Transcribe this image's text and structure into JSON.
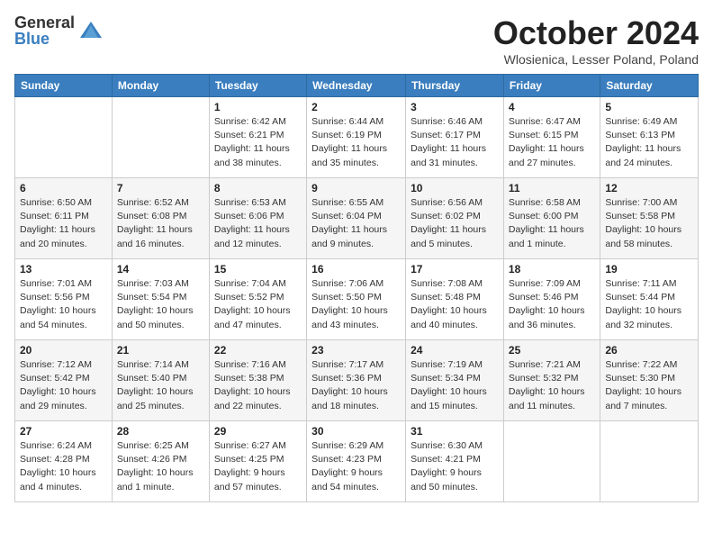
{
  "header": {
    "logo_general": "General",
    "logo_blue": "Blue",
    "month_title": "October 2024",
    "subtitle": "Wlosienica, Lesser Poland, Poland"
  },
  "calendar": {
    "days_of_week": [
      "Sunday",
      "Monday",
      "Tuesday",
      "Wednesday",
      "Thursday",
      "Friday",
      "Saturday"
    ],
    "weeks": [
      [
        {
          "day": "",
          "info": ""
        },
        {
          "day": "",
          "info": ""
        },
        {
          "day": "1",
          "info": "Sunrise: 6:42 AM\nSunset: 6:21 PM\nDaylight: 11 hours and 38 minutes."
        },
        {
          "day": "2",
          "info": "Sunrise: 6:44 AM\nSunset: 6:19 PM\nDaylight: 11 hours and 35 minutes."
        },
        {
          "day": "3",
          "info": "Sunrise: 6:46 AM\nSunset: 6:17 PM\nDaylight: 11 hours and 31 minutes."
        },
        {
          "day": "4",
          "info": "Sunrise: 6:47 AM\nSunset: 6:15 PM\nDaylight: 11 hours and 27 minutes."
        },
        {
          "day": "5",
          "info": "Sunrise: 6:49 AM\nSunset: 6:13 PM\nDaylight: 11 hours and 24 minutes."
        }
      ],
      [
        {
          "day": "6",
          "info": "Sunrise: 6:50 AM\nSunset: 6:11 PM\nDaylight: 11 hours and 20 minutes."
        },
        {
          "day": "7",
          "info": "Sunrise: 6:52 AM\nSunset: 6:08 PM\nDaylight: 11 hours and 16 minutes."
        },
        {
          "day": "8",
          "info": "Sunrise: 6:53 AM\nSunset: 6:06 PM\nDaylight: 11 hours and 12 minutes."
        },
        {
          "day": "9",
          "info": "Sunrise: 6:55 AM\nSunset: 6:04 PM\nDaylight: 11 hours and 9 minutes."
        },
        {
          "day": "10",
          "info": "Sunrise: 6:56 AM\nSunset: 6:02 PM\nDaylight: 11 hours and 5 minutes."
        },
        {
          "day": "11",
          "info": "Sunrise: 6:58 AM\nSunset: 6:00 PM\nDaylight: 11 hours and 1 minute."
        },
        {
          "day": "12",
          "info": "Sunrise: 7:00 AM\nSunset: 5:58 PM\nDaylight: 10 hours and 58 minutes."
        }
      ],
      [
        {
          "day": "13",
          "info": "Sunrise: 7:01 AM\nSunset: 5:56 PM\nDaylight: 10 hours and 54 minutes."
        },
        {
          "day": "14",
          "info": "Sunrise: 7:03 AM\nSunset: 5:54 PM\nDaylight: 10 hours and 50 minutes."
        },
        {
          "day": "15",
          "info": "Sunrise: 7:04 AM\nSunset: 5:52 PM\nDaylight: 10 hours and 47 minutes."
        },
        {
          "day": "16",
          "info": "Sunrise: 7:06 AM\nSunset: 5:50 PM\nDaylight: 10 hours and 43 minutes."
        },
        {
          "day": "17",
          "info": "Sunrise: 7:08 AM\nSunset: 5:48 PM\nDaylight: 10 hours and 40 minutes."
        },
        {
          "day": "18",
          "info": "Sunrise: 7:09 AM\nSunset: 5:46 PM\nDaylight: 10 hours and 36 minutes."
        },
        {
          "day": "19",
          "info": "Sunrise: 7:11 AM\nSunset: 5:44 PM\nDaylight: 10 hours and 32 minutes."
        }
      ],
      [
        {
          "day": "20",
          "info": "Sunrise: 7:12 AM\nSunset: 5:42 PM\nDaylight: 10 hours and 29 minutes."
        },
        {
          "day": "21",
          "info": "Sunrise: 7:14 AM\nSunset: 5:40 PM\nDaylight: 10 hours and 25 minutes."
        },
        {
          "day": "22",
          "info": "Sunrise: 7:16 AM\nSunset: 5:38 PM\nDaylight: 10 hours and 22 minutes."
        },
        {
          "day": "23",
          "info": "Sunrise: 7:17 AM\nSunset: 5:36 PM\nDaylight: 10 hours and 18 minutes."
        },
        {
          "day": "24",
          "info": "Sunrise: 7:19 AM\nSunset: 5:34 PM\nDaylight: 10 hours and 15 minutes."
        },
        {
          "day": "25",
          "info": "Sunrise: 7:21 AM\nSunset: 5:32 PM\nDaylight: 10 hours and 11 minutes."
        },
        {
          "day": "26",
          "info": "Sunrise: 7:22 AM\nSunset: 5:30 PM\nDaylight: 10 hours and 7 minutes."
        }
      ],
      [
        {
          "day": "27",
          "info": "Sunrise: 6:24 AM\nSunset: 4:28 PM\nDaylight: 10 hours and 4 minutes."
        },
        {
          "day": "28",
          "info": "Sunrise: 6:25 AM\nSunset: 4:26 PM\nDaylight: 10 hours and 1 minute."
        },
        {
          "day": "29",
          "info": "Sunrise: 6:27 AM\nSunset: 4:25 PM\nDaylight: 9 hours and 57 minutes."
        },
        {
          "day": "30",
          "info": "Sunrise: 6:29 AM\nSunset: 4:23 PM\nDaylight: 9 hours and 54 minutes."
        },
        {
          "day": "31",
          "info": "Sunrise: 6:30 AM\nSunset: 4:21 PM\nDaylight: 9 hours and 50 minutes."
        },
        {
          "day": "",
          "info": ""
        },
        {
          "day": "",
          "info": ""
        }
      ]
    ]
  }
}
